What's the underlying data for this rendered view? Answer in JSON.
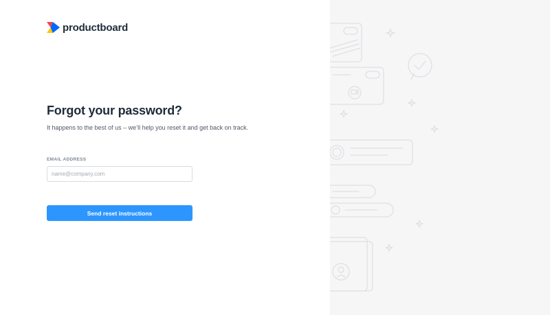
{
  "brand": {
    "name": "productboard",
    "logo_icon": "productboard-logo-icon",
    "colors": {
      "logo_red": "#f4454d",
      "logo_yellow": "#ffc700",
      "logo_blue": "#0069ff"
    }
  },
  "form": {
    "title": "Forgot your password?",
    "subtitle": "It happens to the best of us – we’ll help you reset it and get back on track.",
    "email_label": "EMAIL ADDRESS",
    "email_value": "",
    "email_placeholder": "name@company.com",
    "submit_label": "Send reset instructions"
  },
  "theme": {
    "accent": "#2d96fe",
    "text_dark": "#1f2a3a",
    "panel_background": "#f6f6f7"
  },
  "illustration": {
    "icons": [
      "toggle-card-icon",
      "chat-bubble-icon",
      "video-card-icon",
      "avatar-list-card-icon",
      "sparkle-icon",
      "avatar-card-icon"
    ]
  }
}
